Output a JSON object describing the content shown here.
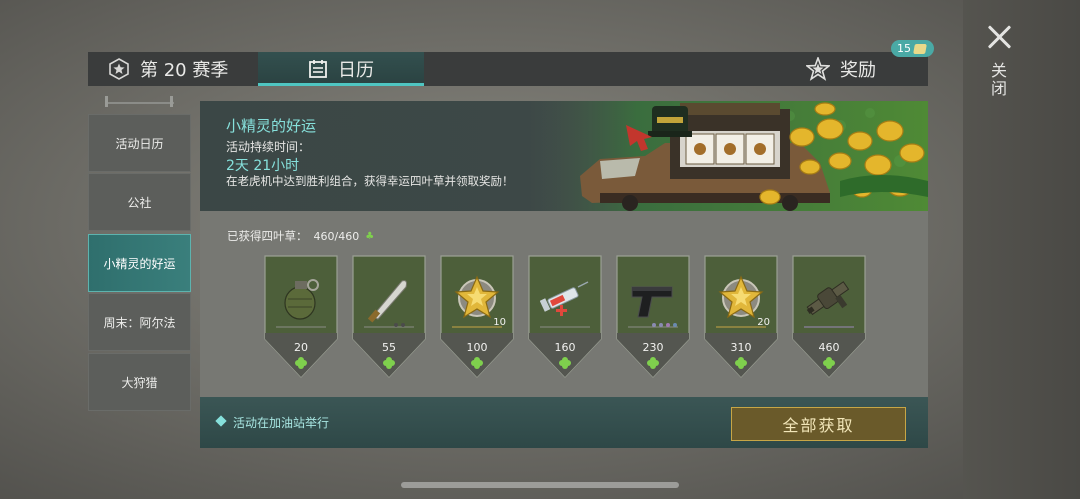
{
  "close": {
    "label": "关闭",
    "icon": "close-icon"
  },
  "tabs": [
    {
      "label": "第 20 赛季",
      "icon": "season-star-icon"
    },
    {
      "label": "日历",
      "icon": "calendar-icon",
      "active": true
    },
    {
      "label": "奖励",
      "icon": "reward-star-icon"
    }
  ],
  "rewards_badge": {
    "count": "15",
    "icon": "ticket-icon"
  },
  "sidebar": {
    "items": [
      {
        "label": "活动日历"
      },
      {
        "label": "公社"
      },
      {
        "label": "小精灵的好运",
        "active": true
      },
      {
        "label": "周末：阿尔法"
      },
      {
        "label": "大狩猎"
      }
    ]
  },
  "event": {
    "title": "小精灵的好运",
    "duration_label": "活动持续时间：",
    "duration_value": "2天 21小时",
    "description": "在老虎机中达到胜利组合，获得幸运四叶草并领取奖励！",
    "progress_label": "已获得四叶草：",
    "progress_value": "460/460",
    "progress_current": 460,
    "progress_max": 460
  },
  "reward_cards": [
    {
      "item": "grenade-icon",
      "cost": "20",
      "qty": ""
    },
    {
      "item": "machete-icon",
      "cost": "55",
      "qty": ""
    },
    {
      "item": "gold-star-badge-icon",
      "cost": "100",
      "qty": "10"
    },
    {
      "item": "syringe-icon",
      "cost": "160",
      "qty": ""
    },
    {
      "item": "pistol-icon",
      "cost": "230",
      "qty": ""
    },
    {
      "item": "gold-star-badge-icon",
      "cost": "310",
      "qty": "20"
    },
    {
      "item": "grenade-launcher-icon",
      "cost": "460",
      "qty": ""
    }
  ],
  "footer": {
    "location_text": "活动在加油站举行",
    "claim_all_label": "全部获取"
  },
  "colors": {
    "accent": "#4fc6c2",
    "accent_text": "#86e0db",
    "card_green": "#4d5f3a",
    "clover": "#7fd04d",
    "claim_border": "#c7a646"
  }
}
